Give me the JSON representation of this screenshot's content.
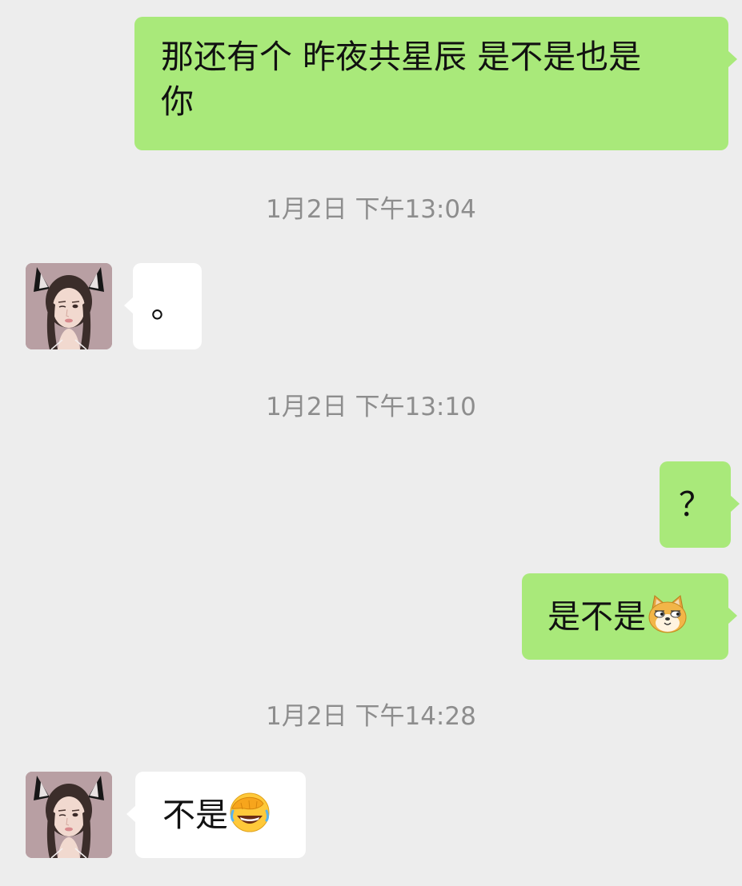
{
  "messages": [
    {
      "text": "那还有个 昨夜共星辰 是不是也是你",
      "line1": "那还有个 昨夜共星辰 是不是也是",
      "line2": "你"
    },
    {
      "text": "。"
    },
    {
      "text": "？"
    },
    {
      "text": "是不是",
      "emoji": "doge-cat-emoji"
    },
    {
      "text": "不是",
      "emoji": "facepalm-laughing-emoji"
    }
  ],
  "timestamps": [
    "1月2日 下午13:04",
    "1月2日 下午13:10",
    "1月2日 下午14:28"
  ],
  "colors": {
    "background": "#ededed",
    "sent_bubble": "#a9e97a",
    "received_bubble": "#ffffff",
    "timestamp_text": "#8d8d8d"
  }
}
